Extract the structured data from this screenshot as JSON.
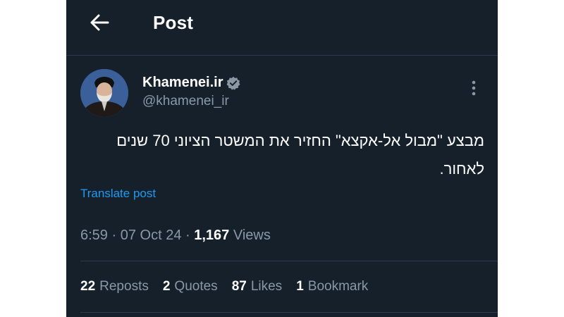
{
  "header": {
    "title": "Post",
    "back_icon": "arrow-left-icon"
  },
  "author": {
    "name": "Khamenei.ir",
    "handle": "@khamenei_ir",
    "verified_icon": "verified-badge-icon",
    "verified_color": "#8b98a5"
  },
  "post": {
    "text": "מבצע \"מבול אל-אקצא\" החזיר את המשטר הציוני 70 שנים לאחור.",
    "translate_label": "Translate post",
    "time": "6:59",
    "date": "07 Oct 24",
    "views_count": "1,167",
    "views_label": "Views"
  },
  "stats": [
    {
      "count": "22",
      "label": "Reposts"
    },
    {
      "count": "2",
      "label": "Quotes"
    },
    {
      "count": "87",
      "label": "Likes"
    },
    {
      "count": "1",
      "label": "Bookmark"
    }
  ],
  "colors": {
    "background": "#15202b",
    "secondary_text": "#8b98a5",
    "link": "#1d9bf0"
  }
}
